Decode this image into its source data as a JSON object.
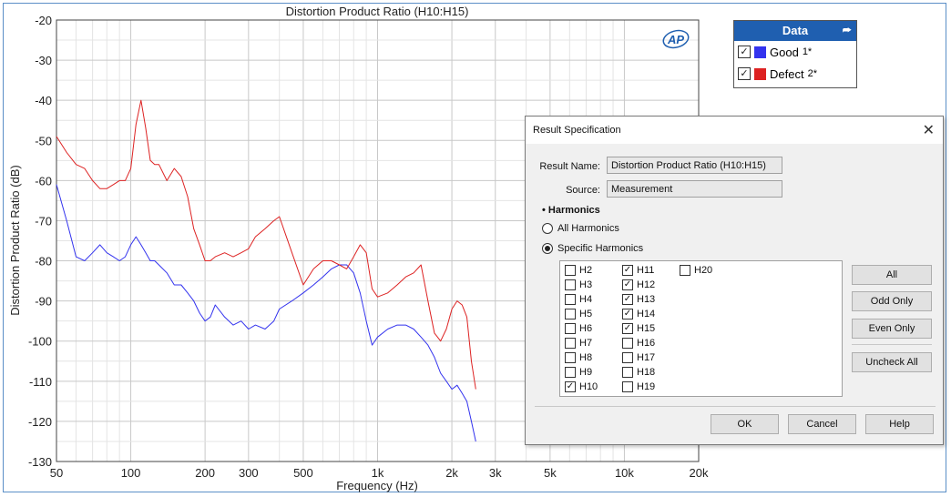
{
  "chart_data": {
    "type": "line",
    "title": "Distortion Product Ratio (H10:H15)",
    "xlabel": "Frequency (Hz)",
    "ylabel": "Distortion Product Ratio (dB)",
    "x_scale": "log",
    "xlim": [
      50,
      20000
    ],
    "ylim": [
      -130,
      -20
    ],
    "x_ticks": [
      50,
      100,
      200,
      300,
      500,
      1000,
      2000,
      3000,
      5000,
      10000,
      20000
    ],
    "x_tick_labels": [
      "50",
      "100",
      "200",
      "300",
      "500",
      "1k",
      "2k",
      "3k",
      "5k",
      "10k",
      "20k"
    ],
    "y_ticks": [
      -20,
      -30,
      -40,
      -50,
      -60,
      -70,
      -80,
      -90,
      -100,
      -110,
      -120,
      -130
    ],
    "y_tick_labels": [
      "-20",
      "-30",
      "-40",
      "-50",
      "-60",
      "-70",
      "-80",
      "-90",
      "-100",
      "-110",
      "-120",
      "-130"
    ],
    "grid": true,
    "series": [
      {
        "name": "Good",
        "color": "#3333ee",
        "x": [
          50,
          55,
          60,
          65,
          70,
          75,
          80,
          85,
          90,
          95,
          100,
          105,
          110,
          115,
          120,
          125,
          130,
          140,
          150,
          160,
          170,
          180,
          190,
          200,
          210,
          220,
          240,
          260,
          280,
          300,
          320,
          350,
          380,
          400,
          450,
          500,
          550,
          600,
          650,
          700,
          750,
          800,
          850,
          900,
          950,
          1000,
          1100,
          1200,
          1300,
          1400,
          1500,
          1600,
          1700,
          1800,
          1900,
          2000,
          2100,
          2200,
          2300,
          2400,
          2500
        ],
        "y": [
          -61,
          -70,
          -79,
          -80,
          -78,
          -76,
          -78,
          -79,
          -80,
          -79,
          -76,
          -74,
          -76,
          -78,
          -80,
          -80,
          -81,
          -83,
          -86,
          -86,
          -88,
          -90,
          -93,
          -95,
          -94,
          -91,
          -94,
          -96,
          -95,
          -97,
          -96,
          -97,
          -95,
          -92,
          -90,
          -88,
          -86,
          -84,
          -82,
          -81,
          -81,
          -83,
          -88,
          -95,
          -101,
          -99,
          -97,
          -96,
          -96,
          -97,
          -99,
          -101,
          -104,
          -108,
          -110,
          -112,
          -111,
          -113,
          -115,
          -120,
          -125
        ]
      },
      {
        "name": "Defect",
        "color": "#dd2222",
        "x": [
          50,
          55,
          60,
          65,
          70,
          75,
          80,
          85,
          90,
          95,
          100,
          105,
          110,
          115,
          120,
          125,
          130,
          140,
          150,
          160,
          170,
          180,
          190,
          200,
          210,
          220,
          240,
          260,
          280,
          300,
          320,
          350,
          380,
          400,
          450,
          500,
          550,
          600,
          650,
          700,
          750,
          800,
          850,
          900,
          950,
          1000,
          1100,
          1200,
          1300,
          1400,
          1500,
          1600,
          1700,
          1800,
          1900,
          2000,
          2100,
          2200,
          2300,
          2400,
          2500
        ],
        "y": [
          -49,
          -53,
          -56,
          -57,
          -60,
          -62,
          -62,
          -61,
          -60,
          -60,
          -57,
          -46,
          -40,
          -47,
          -55,
          -56,
          -56,
          -60,
          -57,
          -59,
          -64,
          -72,
          -76,
          -80,
          -80,
          -79,
          -78,
          -79,
          -78,
          -77,
          -74,
          -72,
          -70,
          -69,
          -78,
          -86,
          -82,
          -80,
          -80,
          -81,
          -82,
          -79,
          -76,
          -78,
          -87,
          -89,
          -88,
          -86,
          -84,
          -83,
          -81,
          -90,
          -98,
          -100,
          -97,
          -92,
          -90,
          -91,
          -94,
          -105,
          -112
        ]
      }
    ],
    "logo": "AP"
  },
  "legend": {
    "title": "Data",
    "pin_icon": "pin-icon",
    "items": [
      {
        "label": "Good",
        "mark": "1*",
        "color": "#3333ee",
        "checked": true
      },
      {
        "label": "Defect",
        "mark": "2*",
        "color": "#dd2222",
        "checked": true
      }
    ]
  },
  "dialog": {
    "title": "Result Specification",
    "close_icon": "close-icon",
    "result_name_label": "Result Name:",
    "result_name_value": "Distortion Product Ratio (H10:H15)",
    "source_label": "Source:",
    "source_value": "Measurement",
    "harmonics_heading": "Harmonics",
    "all_harmonics_label": "All Harmonics",
    "specific_harmonics_label": "Specific Harmonics",
    "selected_mode": "specific",
    "harmonics": [
      {
        "label": "H2",
        "checked": false
      },
      {
        "label": "H3",
        "checked": false
      },
      {
        "label": "H4",
        "checked": false
      },
      {
        "label": "H5",
        "checked": false
      },
      {
        "label": "H6",
        "checked": false
      },
      {
        "label": "H7",
        "checked": false
      },
      {
        "label": "H8",
        "checked": false
      },
      {
        "label": "H9",
        "checked": false
      },
      {
        "label": "H10",
        "checked": true
      },
      {
        "label": "H11",
        "checked": true
      },
      {
        "label": "H12",
        "checked": true
      },
      {
        "label": "H13",
        "checked": true
      },
      {
        "label": "H14",
        "checked": true
      },
      {
        "label": "H15",
        "checked": true
      },
      {
        "label": "H16",
        "checked": false
      },
      {
        "label": "H17",
        "checked": false
      },
      {
        "label": "H18",
        "checked": false
      },
      {
        "label": "H19",
        "checked": false
      },
      {
        "label": "H20",
        "checked": false
      }
    ],
    "buttons": {
      "all": "All",
      "odd_only": "Odd Only",
      "even_only": "Even Only",
      "uncheck_all": "Uncheck All",
      "ok": "OK",
      "cancel": "Cancel",
      "help": "Help"
    }
  }
}
